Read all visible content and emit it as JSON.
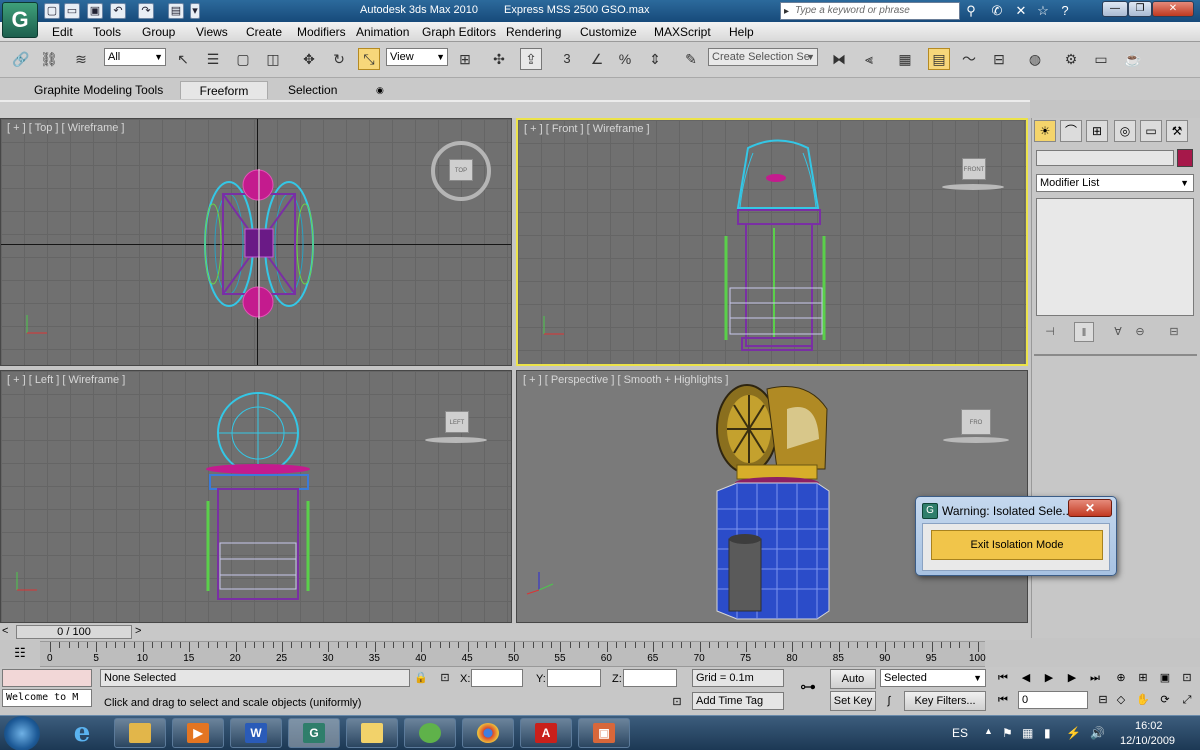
{
  "window": {
    "app_title": "Autodesk 3ds Max  2010",
    "file_title": "Express MSS 2500 GSO.max",
    "search_placeholder": "Type a keyword or phrase",
    "minimize": "—",
    "restore": "❐",
    "close": "✕"
  },
  "menu": [
    "Edit",
    "Tools",
    "Group",
    "Views",
    "Create",
    "Modifiers",
    "Animation",
    "Graph Editors",
    "Rendering",
    "Customize",
    "MAXScript",
    "Help"
  ],
  "toolbar": {
    "filter_value": "All",
    "coord_value": "View",
    "snap_label": "3",
    "selection_set_placeholder": "Create Selection Se"
  },
  "ribbon": {
    "tabs": [
      "Graphite Modeling Tools",
      "Freeform",
      "Selection"
    ],
    "selected": "Freeform"
  },
  "viewports": {
    "top": {
      "label": "[ + ] [ Top ] [ Wireframe ]",
      "cube": "TOP"
    },
    "front": {
      "label": "[ + ] [ Front ] [ Wireframe ]",
      "cube": "FRONT"
    },
    "left": {
      "label": "[ + ] [ Left ] [ Wireframe ]",
      "cube": "LEFT"
    },
    "perspective": {
      "label": "[ + ] [ Perspective ] [ Smooth + Highlights ]",
      "cube": "FRO"
    }
  },
  "command_panel": {
    "modifier_list": "Modifier List"
  },
  "timeline": {
    "frame_display": "0 / 100",
    "ticks": [
      0,
      5,
      10,
      15,
      20,
      25,
      30,
      35,
      40,
      45,
      50,
      55,
      60,
      65,
      70,
      75,
      80,
      85,
      90,
      95,
      100
    ]
  },
  "status": {
    "maxscript_listener": "Welcome to M",
    "selection": "None Selected",
    "prompt": "Click and drag to select and scale objects (uniformly)",
    "x_label": "X:",
    "y_label": "Y:",
    "z_label": "Z:",
    "grid": "Grid = 0.1m",
    "add_time_tag": "Add Time Tag",
    "auto_key": "Auto Key",
    "set_key": "Set Key",
    "key_mode_value": "Selected",
    "key_filters": "Key Filters...",
    "current_frame": "0"
  },
  "dialog": {
    "title": "Warning: Isolated Sele...",
    "close": "✕",
    "button": "Exit Isolation Mode"
  },
  "taskbar": {
    "language": "ES",
    "time": "16:02",
    "date": "12/10/2009",
    "apps": [
      "explorer",
      "media player",
      "W",
      "3ds max",
      "folder",
      "messenger",
      "chrome",
      "pdf",
      "tool"
    ]
  },
  "colors": {
    "active_viewport": "#ece34a",
    "dialog_button": "#f1c54a",
    "object_color": "#a6184a"
  }
}
